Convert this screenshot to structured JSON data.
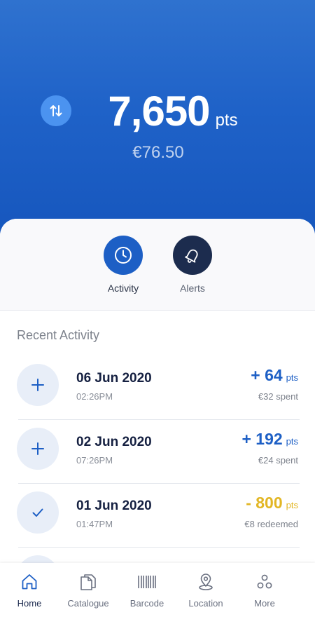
{
  "header": {
    "balance_points": "7,650",
    "balance_unit": "pts",
    "balance_euro": "€76.50",
    "swap_icon": "swap-vertical-icon",
    "colors": {
      "background": "#1f62c8",
      "swap_button": "#4b93f0"
    }
  },
  "toggles": {
    "activity": {
      "label": "Activity",
      "icon": "clock-icon",
      "color": "#1d5fc5"
    },
    "alerts": {
      "label": "Alerts",
      "icon": "bell-icon",
      "color": "#1c2c4e"
    }
  },
  "recent_activity": {
    "title": "Recent Activity",
    "items": [
      {
        "icon": "plus-icon",
        "date": "06 Jun 2020",
        "time": "02:26PM",
        "amount": "+ 64",
        "unit": "pts",
        "detail": "€32 spent",
        "type": "plus"
      },
      {
        "icon": "plus-icon",
        "date": "02 Jun 2020",
        "time": "07:26PM",
        "amount": "+ 192",
        "unit": "pts",
        "detail": "€24 spent",
        "type": "plus"
      },
      {
        "icon": "check-icon",
        "date": "01 Jun 2020",
        "time": "01:47PM",
        "amount": "- 800",
        "unit": "pts",
        "detail": "€8 redeemed",
        "type": "minus"
      }
    ]
  },
  "bottom_nav": {
    "items": [
      {
        "label": "Home",
        "icon": "home-icon",
        "active": true
      },
      {
        "label": "Catalogue",
        "icon": "catalogue-icon",
        "active": false
      },
      {
        "label": "Barcode",
        "icon": "barcode-icon",
        "active": false
      },
      {
        "label": "Location",
        "icon": "location-pin-icon",
        "active": false
      },
      {
        "label": "More",
        "icon": "more-icon",
        "active": false
      }
    ]
  },
  "colors": {
    "accent": "#1d5fc5",
    "points_added": "#1d5fc5",
    "points_redeemed": "#e2b624",
    "navy": "#1c2c4e"
  }
}
